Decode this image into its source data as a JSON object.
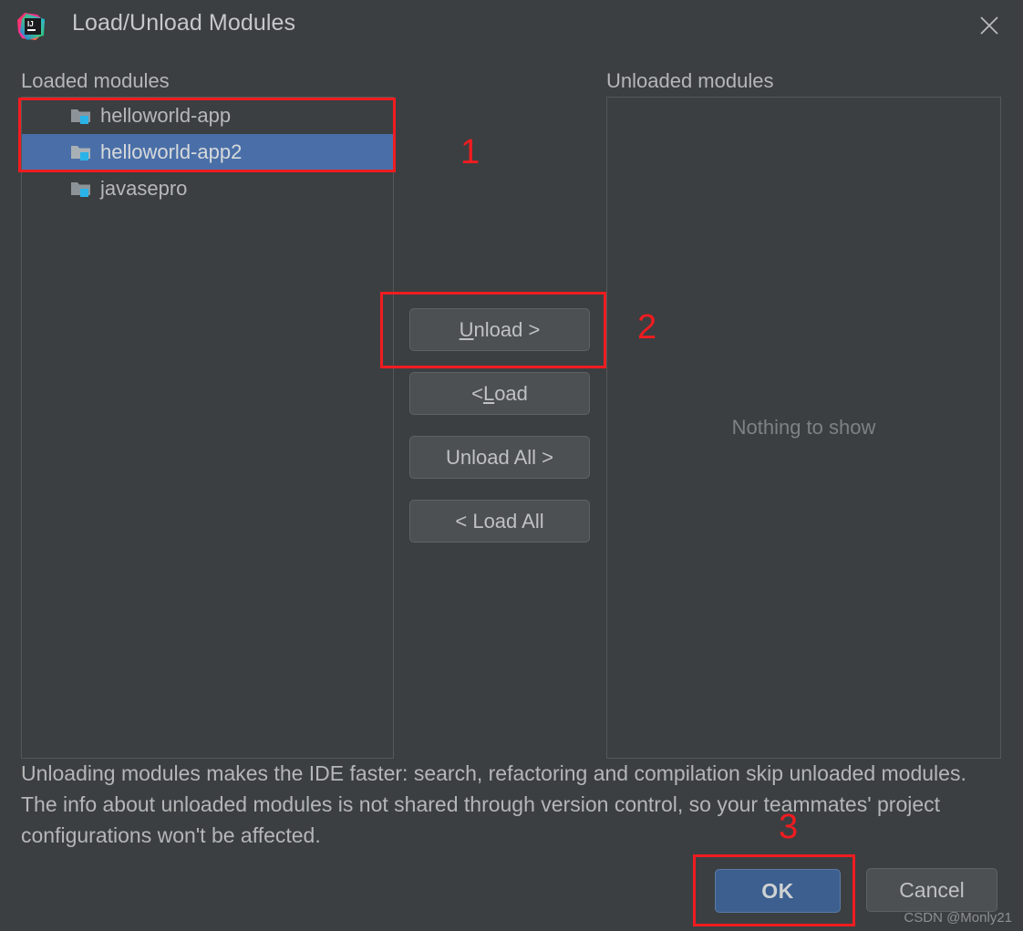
{
  "window": {
    "title": "Load/Unload Modules",
    "app_icon": "intellij-idea-logo",
    "close_icon": "close-icon"
  },
  "loaded": {
    "label": "Loaded modules",
    "items": [
      {
        "name": "helloworld-app",
        "icon": "module-folder-icon",
        "selected": false
      },
      {
        "name": "helloworld-app2",
        "icon": "module-folder-icon",
        "selected": true
      },
      {
        "name": "javasepro",
        "icon": "module-folder-icon",
        "selected": false
      }
    ]
  },
  "unloaded": {
    "label": "Unloaded modules",
    "empty_text": "Nothing to show",
    "items": []
  },
  "transfer_buttons": {
    "unload": {
      "pre": "U",
      "post": "nload >"
    },
    "load": {
      "pre": "< ",
      "mn": "L",
      "post": "oad"
    },
    "unload_all": "Unload All >",
    "load_all": "< Load All"
  },
  "description": "Unloading modules makes the IDE faster: search, refactoring and compilation skip unloaded modules. The info about unloaded modules is not shared through version control, so your teammates' project configurations won't be affected.",
  "footer": {
    "ok_label": "OK",
    "cancel_label": "Cancel"
  },
  "annotations": {
    "one": "1",
    "two": "2",
    "three": "3"
  },
  "watermark": "CSDN @Monly21",
  "colors": {
    "dialog_bg": "#3c3f41",
    "selection_blue": "#4a6fa8",
    "ok_button_blue": "#3c5f8f",
    "annotation_red": "#f01c20",
    "button_gray": "#4c5052",
    "text_gray": "#b4b6b7"
  }
}
